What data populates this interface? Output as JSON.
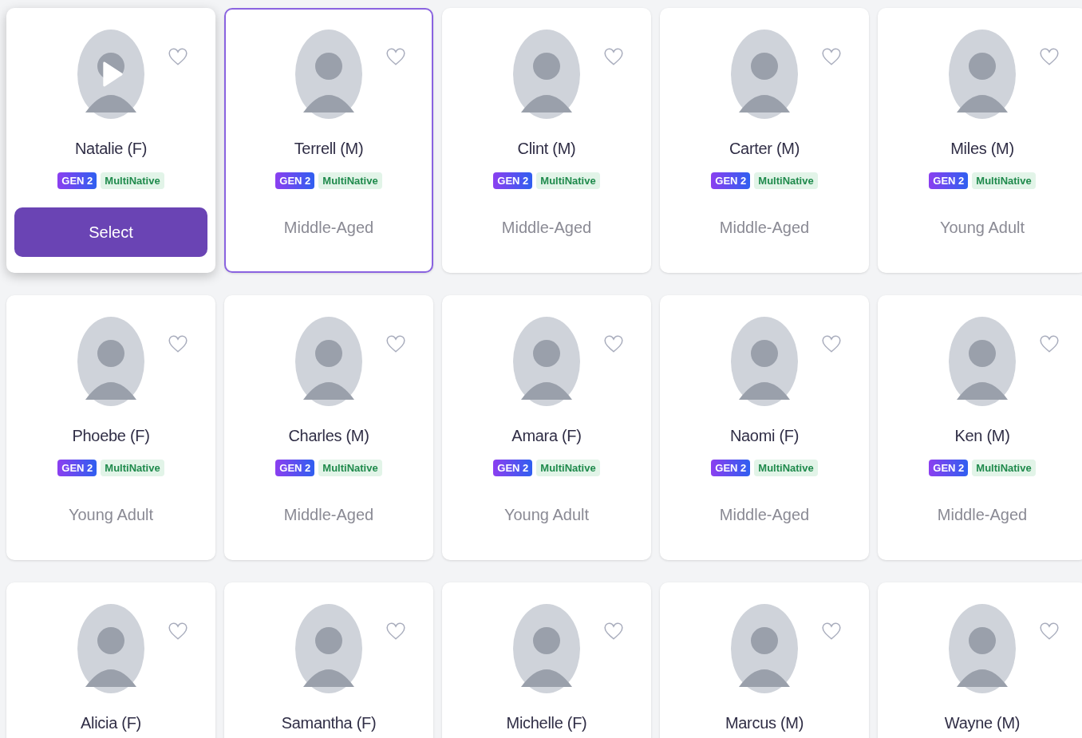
{
  "voices": [
    {
      "name": "Natalie (F)",
      "hovered": true,
      "selected": false,
      "favorite": false,
      "badges": [
        {
          "kind": "gen",
          "label": "GEN 2"
        },
        {
          "kind": "lang",
          "label": "MultiNative"
        }
      ],
      "action_label": "Select"
    },
    {
      "name": "Terrell (M)",
      "hovered": false,
      "selected": true,
      "favorite": false,
      "badges": [
        {
          "kind": "gen",
          "label": "GEN 2"
        },
        {
          "kind": "lang",
          "label": "MultiNative"
        }
      ],
      "age": "Middle-Aged"
    },
    {
      "name": "Clint (M)",
      "hovered": false,
      "selected": false,
      "favorite": false,
      "badges": [
        {
          "kind": "gen",
          "label": "GEN 2"
        },
        {
          "kind": "lang",
          "label": "MultiNative"
        }
      ],
      "age": "Middle-Aged"
    },
    {
      "name": "Carter (M)",
      "hovered": false,
      "selected": false,
      "favorite": false,
      "badges": [
        {
          "kind": "gen",
          "label": "GEN 2"
        },
        {
          "kind": "lang",
          "label": "MultiNative"
        }
      ],
      "age": "Middle-Aged"
    },
    {
      "name": "Miles (M)",
      "hovered": false,
      "selected": false,
      "favorite": false,
      "badges": [
        {
          "kind": "gen",
          "label": "GEN 2"
        },
        {
          "kind": "lang",
          "label": "MultiNative"
        }
      ],
      "age": "Young Adult"
    },
    {
      "name": "Phoebe (F)",
      "hovered": false,
      "selected": false,
      "favorite": false,
      "badges": [
        {
          "kind": "gen",
          "label": "GEN 2"
        },
        {
          "kind": "lang",
          "label": "MultiNative"
        }
      ],
      "age": "Young Adult"
    },
    {
      "name": "Charles (M)",
      "hovered": false,
      "selected": false,
      "favorite": false,
      "badges": [
        {
          "kind": "gen",
          "label": "GEN 2"
        },
        {
          "kind": "lang",
          "label": "MultiNative"
        }
      ],
      "age": "Middle-Aged"
    },
    {
      "name": "Amara (F)",
      "hovered": false,
      "selected": false,
      "favorite": false,
      "badges": [
        {
          "kind": "gen",
          "label": "GEN 2"
        },
        {
          "kind": "lang",
          "label": "MultiNative"
        }
      ],
      "age": "Young Adult"
    },
    {
      "name": "Naomi (F)",
      "hovered": false,
      "selected": false,
      "favorite": false,
      "badges": [
        {
          "kind": "gen",
          "label": "GEN 2"
        },
        {
          "kind": "lang",
          "label": "MultiNative"
        }
      ],
      "age": "Middle-Aged"
    },
    {
      "name": "Ken (M)",
      "hovered": false,
      "selected": false,
      "favorite": false,
      "badges": [
        {
          "kind": "gen",
          "label": "GEN 2"
        },
        {
          "kind": "lang",
          "label": "MultiNative"
        }
      ],
      "age": "Middle-Aged"
    },
    {
      "name": "Alicia (F)",
      "hovered": false,
      "selected": false,
      "favorite": false
    },
    {
      "name": "Samantha (F)",
      "hovered": false,
      "selected": false,
      "favorite": false
    },
    {
      "name": "Michelle (F)",
      "hovered": false,
      "selected": false,
      "favorite": false
    },
    {
      "name": "Marcus (M)",
      "hovered": false,
      "selected": false,
      "favorite": false
    },
    {
      "name": "Wayne (M)",
      "hovered": false,
      "selected": false,
      "favorite": false
    }
  ]
}
